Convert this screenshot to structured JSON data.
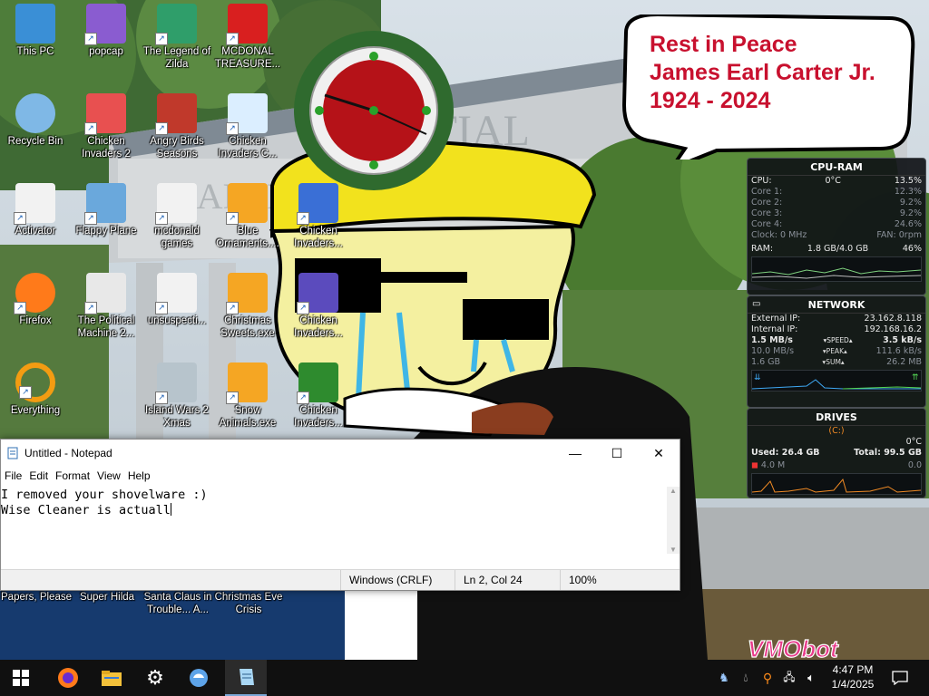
{
  "desktop": {
    "icons": [
      {
        "label": "This PC",
        "icon": "computer-icon"
      },
      {
        "label": "popcap",
        "icon": "popcap-icon"
      },
      {
        "label": "The Legend of Zilda",
        "icon": "game-character-icon"
      },
      {
        "label": "MCDONAL TREASURE...",
        "icon": "mcdonalds-icon"
      },
      {
        "label": "Recycle Bin",
        "icon": "recycle-bin-icon"
      },
      {
        "label": "Chicken Invaders 2",
        "icon": "chicken-invaders-icon"
      },
      {
        "label": "Angry Birds Seasons",
        "icon": "angry-birds-icon"
      },
      {
        "label": "Chicken Invaders C...",
        "icon": "chicken-snowman-icon"
      },
      {
        "label": "Activator",
        "icon": "file-icon"
      },
      {
        "label": "Flappy Plane",
        "icon": "flappy-plane-icon"
      },
      {
        "label": "mcdonald games",
        "icon": "file-icon"
      },
      {
        "label": "Blue Ornaments....",
        "icon": "puzzle-icon"
      },
      {
        "label": "Chicken Invaders...",
        "icon": "chicken-santa-icon"
      },
      {
        "label": "Firefox",
        "icon": "firefox-icon"
      },
      {
        "label": "The Political Machine 2...",
        "icon": "political-machine-icon"
      },
      {
        "label": "unsuspecti...",
        "icon": "file-icon"
      },
      {
        "label": "Christmas Sweets.exe",
        "icon": "puzzle-icon"
      },
      {
        "label": "Chicken Invaders...",
        "icon": "chicken-eggs-icon"
      },
      {
        "label": "Everything",
        "icon": "search-icon"
      },
      {
        "label": "Island Wars 2 Xmas",
        "icon": "island-wars-icon"
      },
      {
        "label": "Snow Animals.exe",
        "icon": "puzzle-icon"
      },
      {
        "label": "Chicken Invaders...",
        "icon": "chicken-red-icon"
      }
    ],
    "bottom_labels": [
      "Papers, Please",
      "Super Hilda",
      "Santa Claus in Trouble... A...",
      "Christmas Eve Crisis"
    ],
    "bubble": {
      "line1": "Rest in Peace",
      "line2": "James Earl Carter Jr.",
      "line3": "1924 - 2024"
    },
    "watermark": "VMObot"
  },
  "gadgets": {
    "cpu_ram": {
      "title": "CPU-RAM",
      "cpu_label": "CPU:",
      "cpu_temp": "0°C",
      "cpu_total": "13.5%",
      "cores": [
        {
          "label": "Core 1:",
          "value": "12.3%"
        },
        {
          "label": "Core 2:",
          "value": "9.2%"
        },
        {
          "label": "Core 3:",
          "value": "9.2%"
        },
        {
          "label": "Core 4:",
          "value": "24.6%"
        }
      ],
      "clock": "Clock: 0 MHz",
      "fan": "FAN: 0rpm",
      "ram_label": "RAM:",
      "ram_value": "1.8 GB/4.0 GB",
      "ram_pct": "46%"
    },
    "network": {
      "title": "NETWORK",
      "ext_label": "External IP:",
      "ext_ip": "23.162.8.118",
      "int_label": "Internal IP:",
      "int_ip": "192.168.16.2",
      "speed_down": "1.5 MB/s",
      "speed_label": "SPEED",
      "speed_up": "3.5 kB/s",
      "peak_down": "10.0 MB/s",
      "peak_label": "PEAK",
      "peak_up": "111.6 kB/s",
      "sum_down": "1.6 GB",
      "sum_label": "SUM",
      "sum_up": "26.2 MB"
    },
    "drives": {
      "title": "DRIVES",
      "drive_letter": "(C:)",
      "temp": "0°C",
      "used": "Used: 26.4 GB",
      "total": "Total: 99.5 GB",
      "read": "4.0 M",
      "write": "0.0"
    }
  },
  "notepad": {
    "title": "Untitled - Notepad",
    "menu": [
      "File",
      "Edit",
      "Format",
      "View",
      "Help"
    ],
    "line1": "I removed your shovelware :)",
    "line2": "Wise Cleaner is actuall",
    "status_eol": "Windows (CRLF)",
    "status_pos": "Ln 2, Col 24",
    "status_zoom": "100%"
  },
  "taskbar": {
    "time": "4:47 PM",
    "date": "1/4/2025"
  }
}
